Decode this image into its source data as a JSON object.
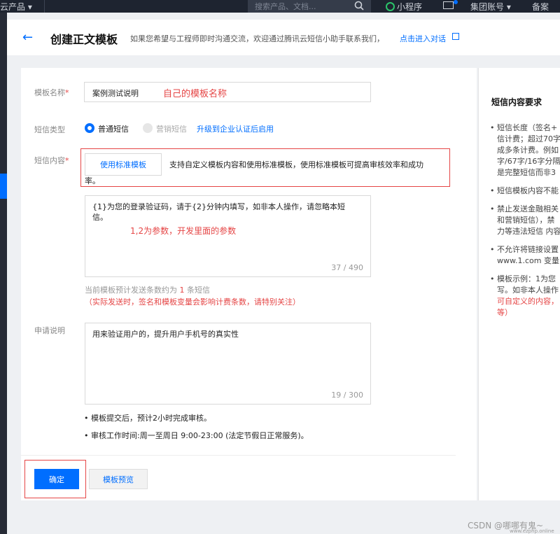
{
  "topnav": {
    "products": "云产品 ▾",
    "search_placeholder": "搜索产品、文档...",
    "mini_program": "小程序",
    "account": "集团账号 ▾",
    "filing": "备案"
  },
  "header": {
    "title": "创建正文模板",
    "hint": "如果您希望与工程师即时沟通交流，欢迎通过腾讯云短信小助手联系我们，",
    "link": "点击进入对话"
  },
  "form": {
    "name_label": "模板名称",
    "name_value": "案例测试说明",
    "name_annotation": "自己的模板名称",
    "type_label": "短信类型",
    "type_option_normal": "普通短信",
    "type_option_marketing": "营销短信",
    "type_upgrade_link": "升级到企业认证后启用",
    "content_label": "短信内容",
    "use_standard_button": "使用标准模板",
    "standard_desc_line1": "支持自定义模板内容和使用标准模板，使用标准模板可提高审核效率和成功",
    "standard_desc_line2": "率。",
    "content_value_line1": "{1}为您的登录验证码，请于{2}分钟内填写，如非本人操作，请忽略本短",
    "content_value_line2": "信。",
    "content_annotation": "1,2为参数，开发里面的参数",
    "content_counter": "37 / 490",
    "estimate_prefix": "当前模板预计发送条数约为 ",
    "estimate_count": "1",
    "estimate_suffix": " 条短信",
    "estimate_note": "（实际发送时，签名和模板变量会影响计费条数，请特别关注）",
    "reason_label": "申请说明",
    "reason_value": "用来验证用户的，提升用户手机号的真实性",
    "reason_counter": "19 / 300",
    "note1": "模板提交后，预计2小时完成审核。",
    "note2": "审核工作时间:周一至周日 9:00-23:00 (法定节假日正常服务)。",
    "confirm_button": "确定",
    "preview_button": "模板预览"
  },
  "right_panel": {
    "title": "短信内容要求",
    "items": [
      {
        "lines": [
          "短信长度（签名+",
          "信计费；超过70字",
          "成多条计费。例如",
          "字/67字/16字分隔",
          "是完整短信而非3"
        ]
      },
      {
        "lines": [
          "短信模板内容不能"
        ]
      },
      {
        "lines": [
          "禁止发送金融相关",
          "和营销短信），禁",
          "力等违法短信 内容"
        ]
      },
      {
        "lines": [
          "不允许将链接设置",
          "www.1.com 变量"
        ]
      },
      {
        "lines": [
          "模板示例：1为您",
          "写。如非本人操作",
          "可自定义的内容，",
          "等）"
        ]
      }
    ]
  },
  "watermark": "CSDN @哪哪有鬼~",
  "watermark2": "www.ezphp.online"
}
